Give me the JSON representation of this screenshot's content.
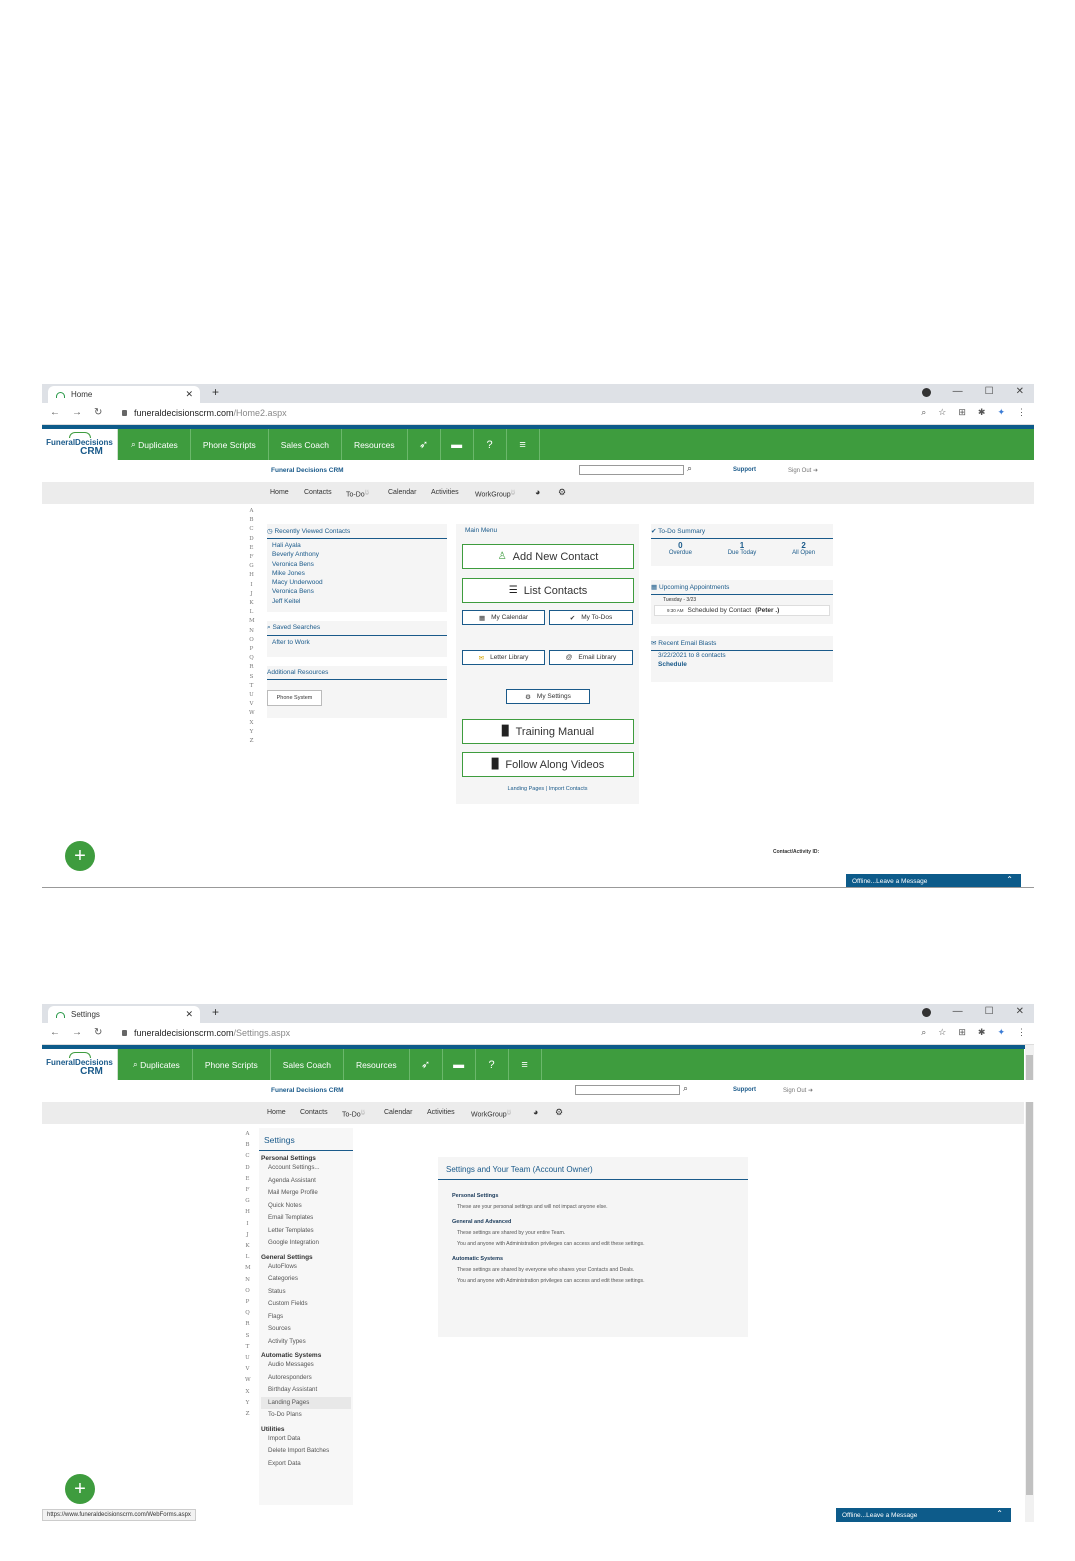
{
  "window1": {
    "tab_title": "Home",
    "url_host": "funeraldecisionscrm.com",
    "url_path": "/Home2.aspx",
    "logo_line1": "FuneralDecisions",
    "logo_line2": "CRM",
    "green_nav": [
      "Duplicates",
      "Phone Scripts",
      "Sales Coach",
      "Resources"
    ],
    "brand": "Funeral Decisions CRM",
    "support": "Support",
    "signout": "Sign Out",
    "nav": [
      "Home",
      "Contacts",
      "To-Do",
      "Calendar",
      "Activities",
      "WorkGroup"
    ],
    "alphabet": [
      "A",
      "B",
      "C",
      "D",
      "E",
      "F",
      "G",
      "H",
      "I",
      "J",
      "K",
      "L",
      "M",
      "N",
      "O",
      "P",
      "Q",
      "R",
      "S",
      "T",
      "U",
      "V",
      "W",
      "X",
      "Y",
      "Z"
    ],
    "recent": {
      "title": "Recently Viewed Contacts",
      "items": [
        "Hali Ayala",
        "Beverly Anthony",
        "Veronica Bens",
        "Mike Jones",
        "Macy Underwood",
        "Veronica Bens",
        "Jeff Keitel"
      ]
    },
    "saved": {
      "title": "Saved Searches",
      "items": [
        "After to Work"
      ]
    },
    "additional": {
      "title": "Additional Resources",
      "button": "Phone System"
    },
    "main_menu": {
      "title": "Main Menu",
      "add_contact": "Add New Contact",
      "list_contacts": "List Contacts",
      "my_calendar": "My Calendar",
      "my_todos": "My To-Dos",
      "letter_library": "Letter Library",
      "email_library": "Email Library",
      "my_settings": "My Settings",
      "training_manual": "Training Manual",
      "follow_videos": "Follow Along Videos",
      "footer_links": "Landing Pages | Import Contacts"
    },
    "todo": {
      "title": "To-Do Summary",
      "overdue": "0",
      "overdue_label": "Overdue",
      "due_today": "1",
      "due_today_label": "Due Today",
      "all_open": "2",
      "all_open_label": "All Open"
    },
    "appointments": {
      "title": "Upcoming Appointments",
      "date": "Tuesday - 3/23",
      "time": "9:30 AM",
      "text": "Scheduled by Contact",
      "who": "(Peter .)"
    },
    "email_blasts": {
      "title": "Recent Email Blasts",
      "line": "3/22/2021 to 8 contacts",
      "action": "Schedule"
    },
    "contact_activity_id": "Contact/Activity ID:",
    "chat": "Offline...Leave a Message"
  },
  "window2": {
    "tab_title": "Settings",
    "url_host": "funeraldecisionscrm.com",
    "url_path": "/Settings.aspx",
    "settings_title": "Settings",
    "groups": [
      {
        "header": "Personal Settings",
        "items": [
          "Account Settings...",
          "Agenda Assistant",
          "Mail Merge Profile",
          "Quick Notes",
          "Email Templates",
          "Letter Templates",
          "Google Integration"
        ]
      },
      {
        "header": "General Settings",
        "items": [
          "AutoFlows",
          "Categories",
          "Status",
          "Custom Fields",
          "Flags",
          "Sources",
          "Activity Types"
        ]
      },
      {
        "header": "Automatic Systems",
        "items": [
          "Audio Messages",
          "Autoresponders",
          "Birthday Assistant",
          "Landing Pages",
          "To-Do Plans"
        ]
      },
      {
        "header": "Utilities",
        "items": [
          "Import Data",
          "Delete Import Batches",
          "Export Data"
        ]
      }
    ],
    "main_title": "Settings and Your Team (Account Owner)",
    "sections": [
      {
        "h": "Personal Settings",
        "p": [
          "These are your personal settings and will not impact anyone else."
        ]
      },
      {
        "h": "General and Advanced",
        "p": [
          "These settings are shared by your entire Team.",
          "You and anyone with Administration privileges can access and edit these settings."
        ]
      },
      {
        "h": "Automatic Systems",
        "p": [
          "These settings are shared by everyone who shares your Contacts and Deals.",
          "You and anyone with Administration privileges can access and edit these settings."
        ]
      }
    ],
    "status_url": "https://www.funeraldecisionscrm.com/WebForms.aspx",
    "chat": "Offline...Leave a Message"
  }
}
